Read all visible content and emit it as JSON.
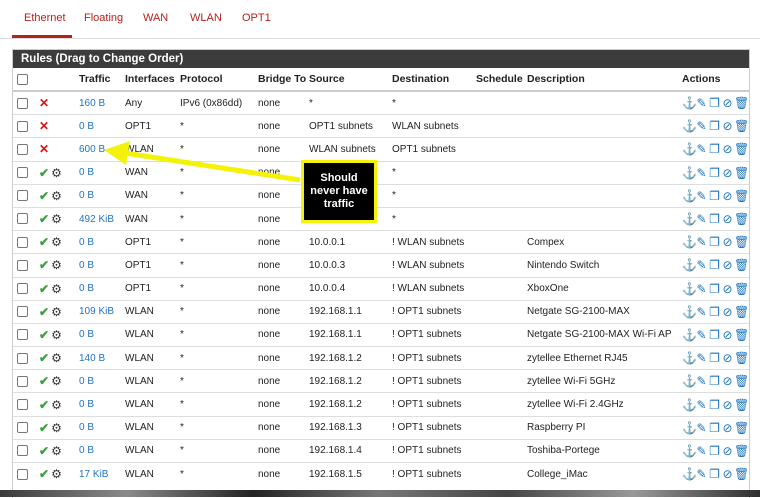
{
  "tabs": [
    "Ethernet",
    "Floating",
    "WAN",
    "WLAN",
    "OPT1"
  ],
  "panel_title": "Rules (Drag to Change Order)",
  "columns": [
    "Traffic",
    "Interfaces",
    "Protocol",
    "Bridge To",
    "Source",
    "Destination",
    "Schedule",
    "Description",
    "Actions"
  ],
  "rows": [
    {
      "status": "blocked",
      "traffic": "160 B",
      "iface": "Any",
      "proto": "IPv6 (0x86dd)",
      "bridge": "none",
      "source": "*",
      "dest": "*",
      "schedule": "",
      "desc": ""
    },
    {
      "status": "blocked",
      "traffic": "0 B",
      "iface": "OPT1",
      "proto": "*",
      "bridge": "none",
      "source": "OPT1 subnets",
      "dest": "WLAN subnets",
      "schedule": "",
      "desc": ""
    },
    {
      "status": "blocked",
      "traffic": "600 B",
      "iface": "WLAN",
      "proto": "*",
      "bridge": "none",
      "source": "WLAN subnets",
      "dest": "OPT1 subnets",
      "schedule": "",
      "desc": ""
    },
    {
      "status": "pass",
      "traffic": "0 B",
      "iface": "WAN",
      "proto": "*",
      "bridge": "none",
      "source": "*",
      "dest": "*",
      "schedule": "",
      "desc": ""
    },
    {
      "status": "pass",
      "traffic": "0 B",
      "iface": "WAN",
      "proto": "*",
      "bridge": "none",
      "source": "*",
      "dest": "*",
      "schedule": "",
      "desc": ""
    },
    {
      "status": "pass",
      "traffic": "492 KiB",
      "iface": "WAN",
      "proto": "*",
      "bridge": "none",
      "source": "*",
      "dest": "*",
      "schedule": "",
      "desc": ""
    },
    {
      "status": "pass",
      "traffic": "0 B",
      "iface": "OPT1",
      "proto": "*",
      "bridge": "none",
      "source": "10.0.0.1",
      "dest": "! WLAN subnets",
      "schedule": "",
      "desc": "Compex"
    },
    {
      "status": "pass",
      "traffic": "0 B",
      "iface": "OPT1",
      "proto": "*",
      "bridge": "none",
      "source": "10.0.0.3",
      "dest": "! WLAN subnets",
      "schedule": "",
      "desc": "Nintendo Switch"
    },
    {
      "status": "pass",
      "traffic": "0 B",
      "iface": "OPT1",
      "proto": "*",
      "bridge": "none",
      "source": "10.0.0.4",
      "dest": "! WLAN subnets",
      "schedule": "",
      "desc": "XboxOne"
    },
    {
      "status": "pass",
      "traffic": "109 KiB",
      "iface": "WLAN",
      "proto": "*",
      "bridge": "none",
      "source": "192.168.1.1",
      "dest": "! OPT1 subnets",
      "schedule": "",
      "desc": "Netgate SG-2100-MAX"
    },
    {
      "status": "pass",
      "traffic": "0 B",
      "iface": "WLAN",
      "proto": "*",
      "bridge": "none",
      "source": "192.168.1.1",
      "dest": "! OPT1 subnets",
      "schedule": "",
      "desc": "Netgate SG-2100-MAX Wi-Fi AP"
    },
    {
      "status": "pass",
      "traffic": "140 B",
      "iface": "WLAN",
      "proto": "*",
      "bridge": "none",
      "source": "192.168.1.2",
      "dest": "! OPT1 subnets",
      "schedule": "",
      "desc": "zytellee Ethernet RJ45"
    },
    {
      "status": "pass",
      "traffic": "0 B",
      "iface": "WLAN",
      "proto": "*",
      "bridge": "none",
      "source": "192.168.1.2",
      "dest": "! OPT1 subnets",
      "schedule": "",
      "desc": "zytellee Wi-Fi 5GHz"
    },
    {
      "status": "pass",
      "traffic": "0 B",
      "iface": "WLAN",
      "proto": "*",
      "bridge": "none",
      "source": "192.168.1.2",
      "dest": "! OPT1 subnets",
      "schedule": "",
      "desc": "zytellee Wi-Fi 2.4GHz"
    },
    {
      "status": "pass",
      "traffic": "0 B",
      "iface": "WLAN",
      "proto": "*",
      "bridge": "none",
      "source": "192.168.1.3",
      "dest": "! OPT1 subnets",
      "schedule": "",
      "desc": "Raspberry PI"
    },
    {
      "status": "pass",
      "traffic": "0 B",
      "iface": "WLAN",
      "proto": "*",
      "bridge": "none",
      "source": "192.168.1.4",
      "dest": "! OPT1 subnets",
      "schedule": "",
      "desc": "Toshiba-Portege"
    },
    {
      "status": "pass",
      "traffic": "17 KiB",
      "iface": "WLAN",
      "proto": "*",
      "bridge": "none",
      "source": "192.168.1.5",
      "dest": "! OPT1 subnets",
      "schedule": "",
      "desc": "College_iMac"
    }
  ],
  "callout": "Should never have traffic",
  "colors": {
    "accent": "#b2231e",
    "link": "#1e73be",
    "header_bg": "#3c3c3c",
    "callout_border": "#f5f20a"
  },
  "icons": {
    "blocked": "close-icon",
    "pass": "check-icon",
    "settings": "gear-icon",
    "actions": [
      "anchor-icon",
      "edit-icon",
      "copy-icon",
      "disable-icon",
      "trash-icon"
    ]
  }
}
